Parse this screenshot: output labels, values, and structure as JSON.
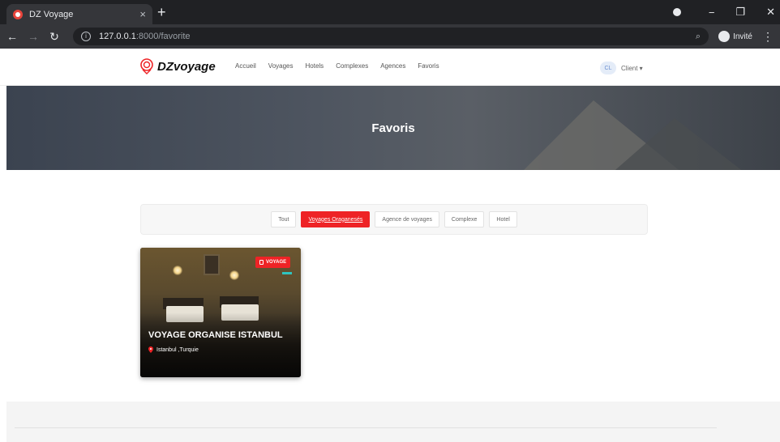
{
  "browser": {
    "tab_title": "DZ Voyage",
    "tab_close": "×",
    "new_tab": "+",
    "url_host": "127.0.0.1",
    "url_path": ":8000/favorite",
    "guest_label": "Invité",
    "win_min": "−",
    "win_restore": "❐",
    "win_close": "✕"
  },
  "header": {
    "logo_text": "DZvoyage",
    "nav": [
      "Accueil",
      "Voyages",
      "Hotels",
      "Complexes",
      "Agences",
      "Favoris"
    ],
    "client_initials": "CL",
    "client_label": "Client ▾"
  },
  "hero": {
    "title": "Favoris"
  },
  "filters": {
    "items": [
      "Tout",
      "Voyages Oraganesés",
      "Agence de voyages",
      "Complexe",
      "Hotel"
    ],
    "active_index": 1
  },
  "card": {
    "badge": "VOYAGE",
    "title": "VOYAGE ORGANISE ISTANBUL",
    "location": "Istanbul ,Turquie"
  },
  "colors": {
    "accent": "#ee2326",
    "teal": "#2ec4c0"
  }
}
